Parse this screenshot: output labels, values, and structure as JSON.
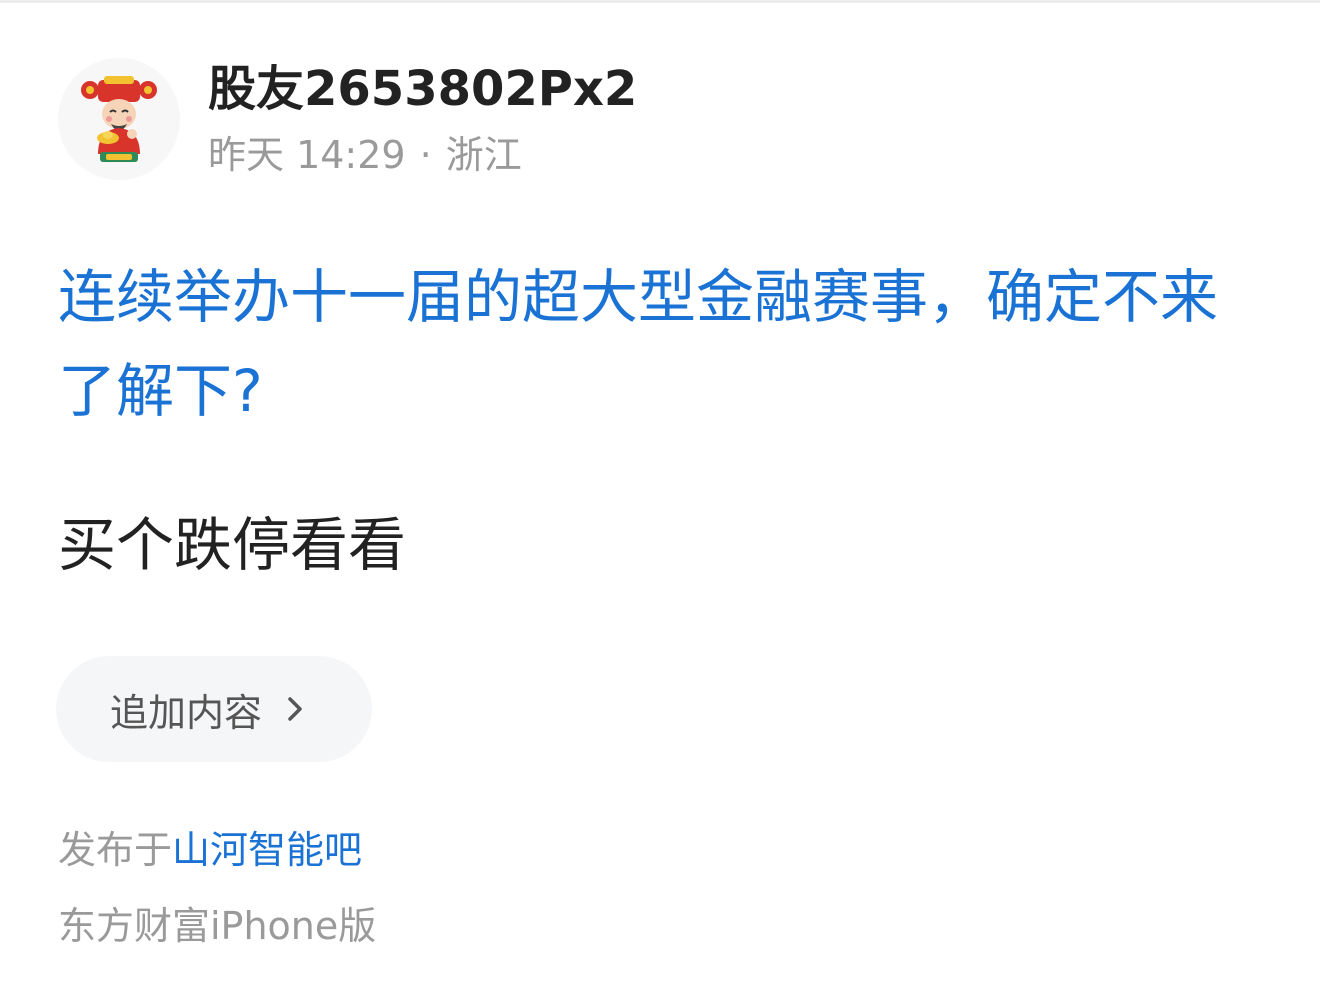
{
  "post": {
    "author": {
      "name": "股友2653802Px2",
      "avatar_icon": "caishen-avatar-icon"
    },
    "time": "昨天 14:29",
    "separator": "·",
    "location": "浙江",
    "title": "连续举办十一届的超大型金融赛事，确定不来了解下?",
    "content": "买个跌停看看",
    "append_button": {
      "label": "追加内容",
      "icon": "chevron-right-icon"
    },
    "published_prefix": "发布于",
    "forum_name": "山河智能吧",
    "client": "东方财富iPhone版"
  },
  "colors": {
    "link_blue": "#1a73d4",
    "text_dark": "#222222",
    "text_gray": "#9a9a9a",
    "button_bg": "#f5f6f8"
  }
}
